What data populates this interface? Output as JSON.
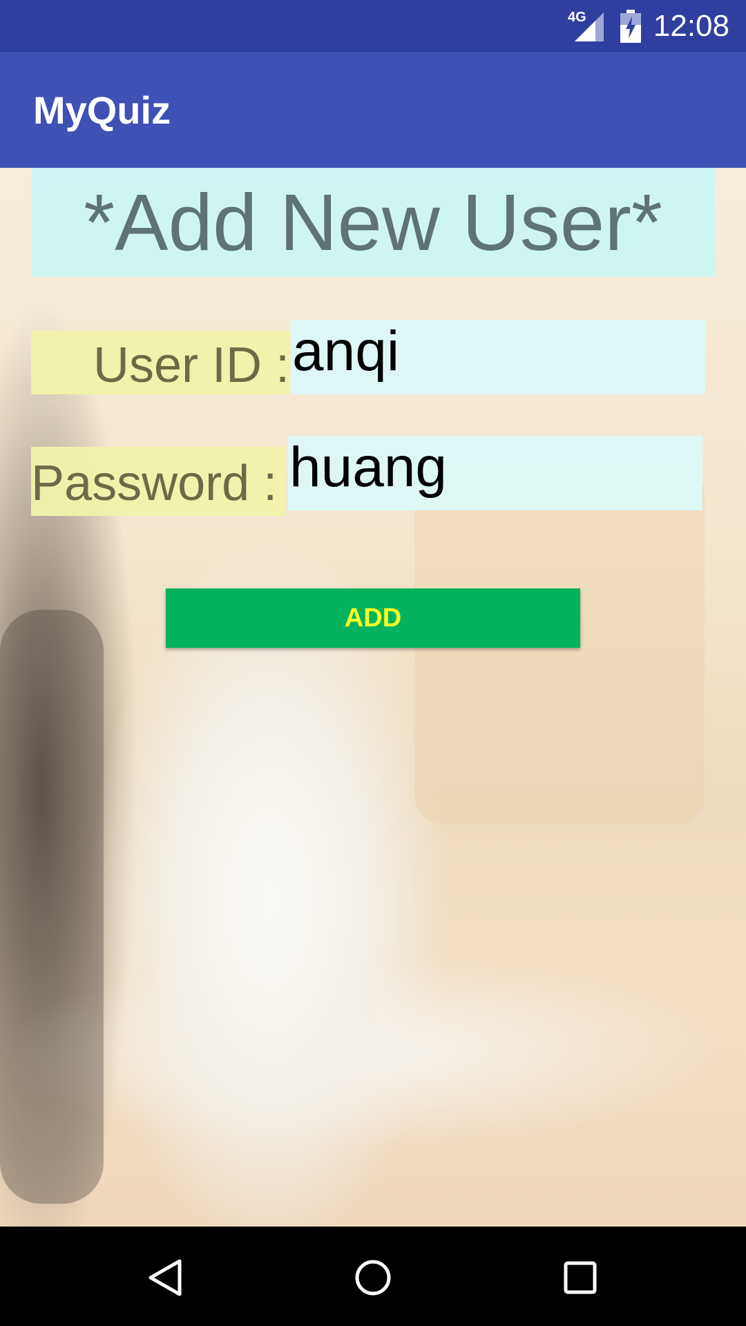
{
  "status_bar": {
    "network": "4G",
    "time": "12:08",
    "icons": [
      "signal-icon",
      "battery-icon"
    ]
  },
  "app_bar": {
    "title": "MyQuiz"
  },
  "form": {
    "heading": "*Add New User*",
    "user_id_label": "User  ID :",
    "user_id_value": "anqi",
    "password_label": "Password :",
    "password_value": "huang",
    "add_button_label": "ADD"
  },
  "nav_bar": {
    "icons": [
      "back-icon",
      "home-icon",
      "recent-apps-icon"
    ]
  },
  "colors": {
    "status_bar": "#303F9F",
    "app_bar": "#3F51B5",
    "heading_bg": "#CCF6F4",
    "label_bg": "#F0F2AA",
    "input_bg": "#DCF8F8",
    "button_bg": "#05B35E",
    "button_text": "#FFFF26"
  }
}
